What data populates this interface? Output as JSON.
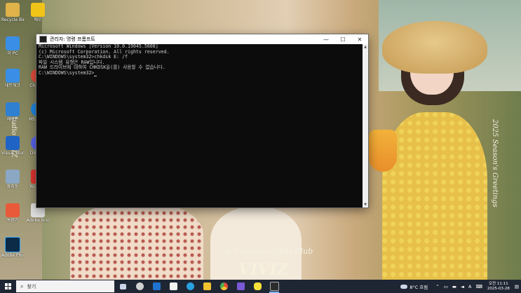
{
  "desktop_icons": [
    {
      "label": "Recycle Bin",
      "color": "#e0b24a"
    },
    {
      "label": "이 PC",
      "color": "#3a8ee6"
    },
    {
      "label": "네트워크",
      "color": "#3a8ee6"
    },
    {
      "label": "제어판",
      "color": "#2f80d1"
    },
    {
      "label": "Visual Studio",
      "color": "#1f64c4"
    },
    {
      "label": "휴지통",
      "color": "#8aa7c4"
    },
    {
      "label": "녹음기",
      "color": "#e85a3a"
    },
    {
      "label": "Adobe Photoshop",
      "color": "#0b2b47"
    },
    {
      "label": "메모",
      "color": "#f0c419"
    },
    {
      "label": "Chrome",
      "color": "#e74c3c"
    },
    {
      "label": "MS Edge",
      "color": "#1e88e5"
    },
    {
      "label": "Discord",
      "color": "#5865f2"
    },
    {
      "label": "YouTube",
      "color": "#e3342f"
    },
    {
      "label": "Adobe Bridge Pro",
      "color": "#e0e0e0"
    }
  ],
  "wallpaper": {
    "club_text": "A Vivacious Girls Club",
    "brand_text": "VIVIZ",
    "signature_text": "2025 Season's Greetings",
    "studio_text": "Studio ViVIZ"
  },
  "window": {
    "title": "관리자: 명령 프롬프트",
    "minimize": "—",
    "maximize": "☐",
    "close": "✕",
    "console_lines": [
      "Microsoft Windows [Version 10.0.19045.5608]",
      "(c) Microsoft Corporation. All rights reserved.",
      "",
      "C:\\WINDOWS\\system32>chkdsk E: /f",
      "파일 시스템 유형은 RAW입니다.",
      "RAW 드라이브에 대하여 CHKDSK을(를) 사용할 수 없습니다.",
      "",
      "C:\\WINDOWS\\system32>"
    ]
  },
  "taskbar": {
    "search_placeholder": "찾기",
    "apps": [
      {
        "name": "task-view",
        "color": "#c9d4e8"
      },
      {
        "name": "settings",
        "color": "#d0d0d0"
      },
      {
        "name": "outlook",
        "color": "#1f73d1"
      },
      {
        "name": "store",
        "color": "#f2f2f2"
      },
      {
        "name": "edge",
        "color": "#2aa0e0"
      },
      {
        "name": "explorer",
        "color": "#f1c232"
      },
      {
        "name": "chrome",
        "color": "#4caf50"
      },
      {
        "name": "notes",
        "color": "#7a59d6"
      },
      {
        "name": "kakaotalk",
        "color": "#f7e03a"
      },
      {
        "name": "cmd",
        "color": "#2c2c2c"
      }
    ],
    "weather": "8°C 흐림",
    "ime": "A",
    "time": "오전 11:11",
    "date": "2025-03-28"
  }
}
